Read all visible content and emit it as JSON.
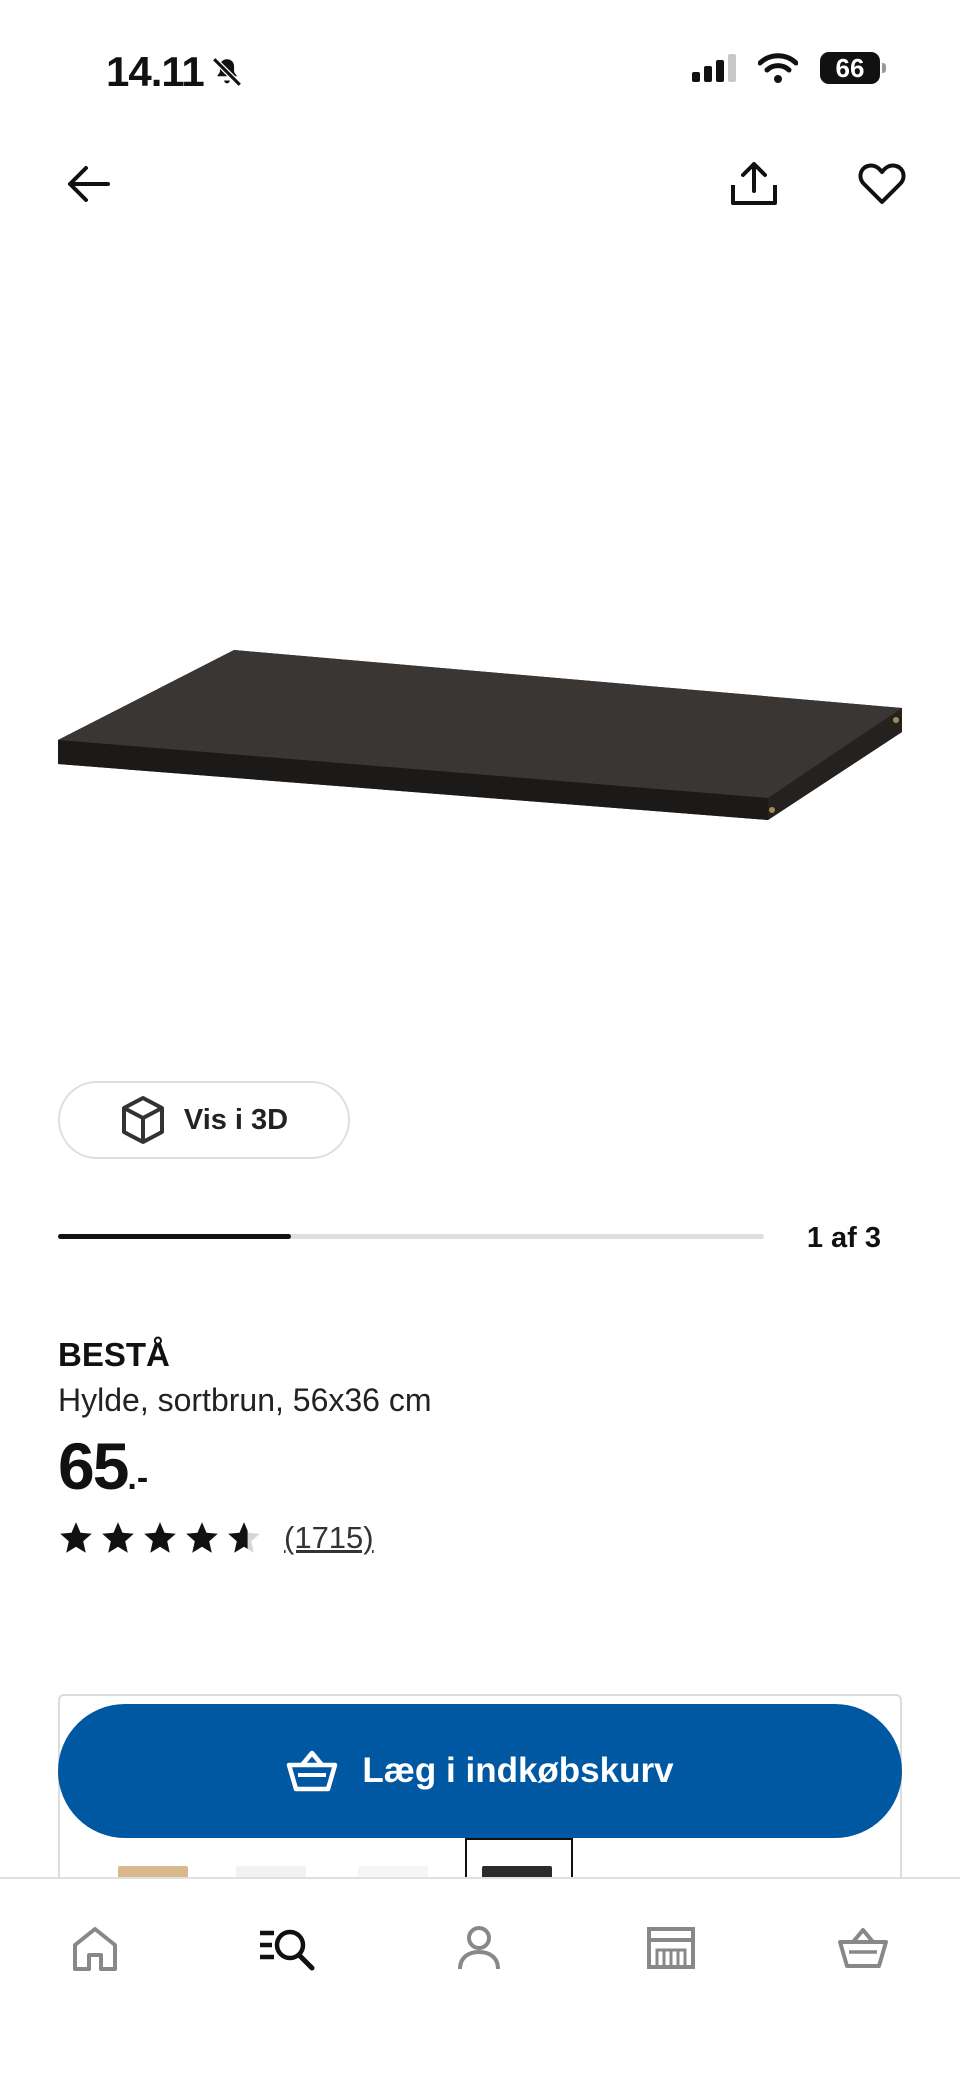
{
  "status_bar": {
    "time": "14.11",
    "battery": "66"
  },
  "product": {
    "view_3d_label": "Vis i 3D",
    "image_progress": 0.33,
    "page_indicator": "1 af 3",
    "brand": "BESTÅ",
    "description": "Hylde, sortbrun, 56x36 cm",
    "price": "65",
    "price_suffix": ".-",
    "rating": 4.6,
    "review_count": "(1715)"
  },
  "cart": {
    "add_label": "Læg i indkøbskurv"
  },
  "colors": {
    "accent": "#0058a3",
    "text": "#111111"
  },
  "bottom_nav": [
    {
      "icon": "home-icon"
    },
    {
      "icon": "search-icon"
    },
    {
      "icon": "profile-icon"
    },
    {
      "icon": "store-icon"
    },
    {
      "icon": "basket-icon"
    }
  ]
}
